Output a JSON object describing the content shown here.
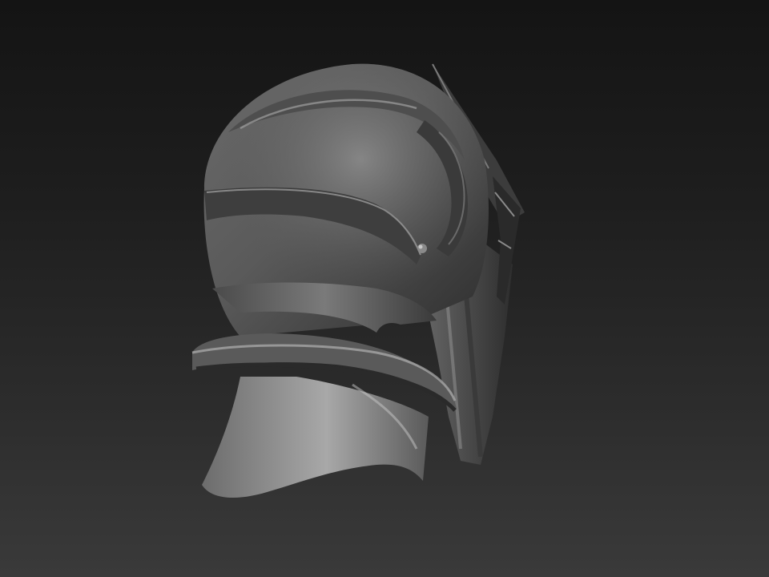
{
  "scene": {
    "subject_icon": "armored-helmet-sculpt-icon",
    "colors": {
      "background_top": "#141414",
      "background_bottom": "#3a3a3a",
      "material_dark": "#2f2f2f",
      "material_mid": "#5a5a5a",
      "material_light": "#9a9a9a",
      "specular": "#c8c8c8"
    }
  }
}
